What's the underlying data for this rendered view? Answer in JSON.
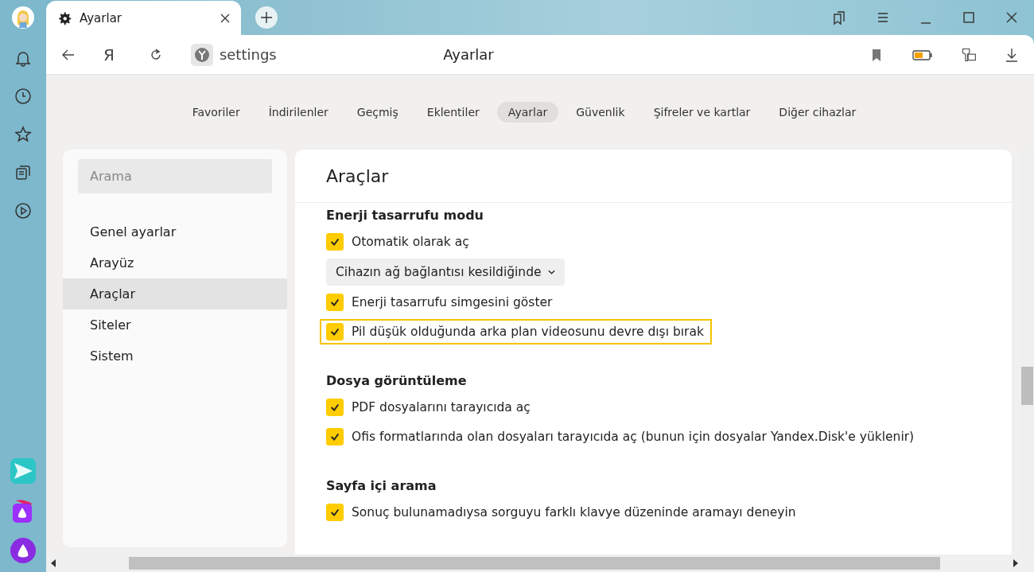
{
  "tab": {
    "title": "Ayarlar"
  },
  "address": {
    "url": "settings",
    "page_title": "Ayarlar",
    "yandex_key": "Я"
  },
  "nav_tabs": [
    {
      "label": "Favoriler",
      "selected": false
    },
    {
      "label": "İndirilenler",
      "selected": false
    },
    {
      "label": "Geçmiş",
      "selected": false
    },
    {
      "label": "Eklentiler",
      "selected": false
    },
    {
      "label": "Ayarlar",
      "selected": true
    },
    {
      "label": "Güvenlik",
      "selected": false
    },
    {
      "label": "Şifreler ve kartlar",
      "selected": false
    },
    {
      "label": "Diğer cihazlar",
      "selected": false
    }
  ],
  "sidebar": {
    "search": {
      "placeholder": "Arama"
    },
    "items": [
      {
        "label": "Genel ayarlar",
        "selected": false
      },
      {
        "label": "Arayüz",
        "selected": false
      },
      {
        "label": "Araçlar",
        "selected": true
      },
      {
        "label": "Siteler",
        "selected": false
      },
      {
        "label": "Sistem",
        "selected": false
      }
    ]
  },
  "panel": {
    "title": "Araçlar",
    "sections": [
      {
        "title": "Enerji tasarrufu modu",
        "items": [
          {
            "kind": "checkbox",
            "label": "Otomatik olarak aç",
            "checked": true,
            "highlighted": false
          },
          {
            "kind": "dropdown",
            "label": "Cihazın ağ bağlantısı kesildiğinde"
          },
          {
            "kind": "checkbox",
            "label": "Enerji tasarrufu simgesini göster",
            "checked": true,
            "highlighted": false
          },
          {
            "kind": "checkbox",
            "label": "Pil düşük olduğunda arka plan videosunu devre dışı bırak",
            "checked": true,
            "highlighted": true
          }
        ]
      },
      {
        "title": "Dosya görüntüleme",
        "items": [
          {
            "kind": "checkbox",
            "label": "PDF dosyalarını tarayıcıda aç",
            "checked": true,
            "highlighted": false
          },
          {
            "kind": "checkbox",
            "label": "Ofis formatlarında olan dosyaları tarayıcıda aç (bunun için dosyalar Yandex.Disk'e yüklenir)",
            "checked": true,
            "highlighted": false
          }
        ]
      },
      {
        "title": "Sayfa içi arama",
        "items": [
          {
            "kind": "checkbox",
            "label": "Sonuç bulunamadıysa sorguyu farklı klavye düzeninde aramayı deneyin",
            "checked": true,
            "highlighted": false
          }
        ]
      }
    ]
  }
}
